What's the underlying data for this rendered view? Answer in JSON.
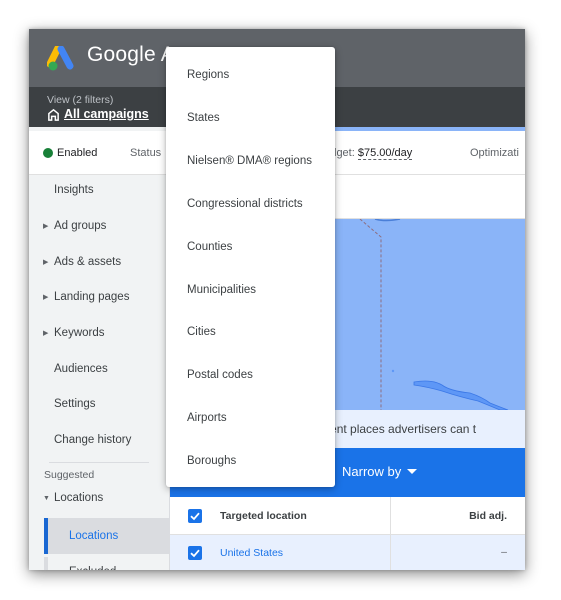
{
  "app": {
    "brand": "Google Ads",
    "brand_visible": "Google A",
    "logo_icon": "google-ads-logo"
  },
  "view": {
    "label": "View (2 filters)",
    "link": "All campaigns",
    "icon": "home-icon"
  },
  "status_bar": {
    "enabled": "Enabled",
    "status_label": "Status",
    "budget_prefix": "lget: ",
    "budget_value": "$75.00/day",
    "optimization": "Optimizati",
    "colors": {
      "enabled_dot": "#188038"
    }
  },
  "sidebar": {
    "items": [
      {
        "label": "Insights",
        "caret": false
      },
      {
        "label": "Ad groups",
        "caret": true
      },
      {
        "label": "Ads & assets",
        "caret": true
      },
      {
        "label": "Landing pages",
        "caret": true
      },
      {
        "label": "Keywords",
        "caret": true
      },
      {
        "label": "Audiences",
        "caret": false
      },
      {
        "label": "Settings",
        "caret": false
      },
      {
        "label": "Change history",
        "caret": false
      }
    ],
    "section_label": "Suggested",
    "expanded_group": "Locations",
    "sub_items": [
      {
        "label": "Locations",
        "active": true
      },
      {
        "label": "Excluded",
        "active": false
      }
    ]
  },
  "map": {
    "caption": "epresent places advertisers can t",
    "colors": {
      "fill": "#8ab4f8"
    }
  },
  "narrow_by": {
    "label": "Narrow by",
    "bar_color": "#1a73e8"
  },
  "table": {
    "columns": [
      "Targeted location",
      "Bid adj."
    ],
    "rows": [
      {
        "location": "United States",
        "bid_adj": "–",
        "checked": true
      }
    ],
    "header_checked": true
  },
  "dropdown": {
    "items": [
      "Regions",
      "States",
      "Nielsen® DMA® regions",
      "Congressional districts",
      "Counties",
      "Municipalities",
      "Cities",
      "Postal codes",
      "Airports",
      "Boroughs"
    ]
  }
}
